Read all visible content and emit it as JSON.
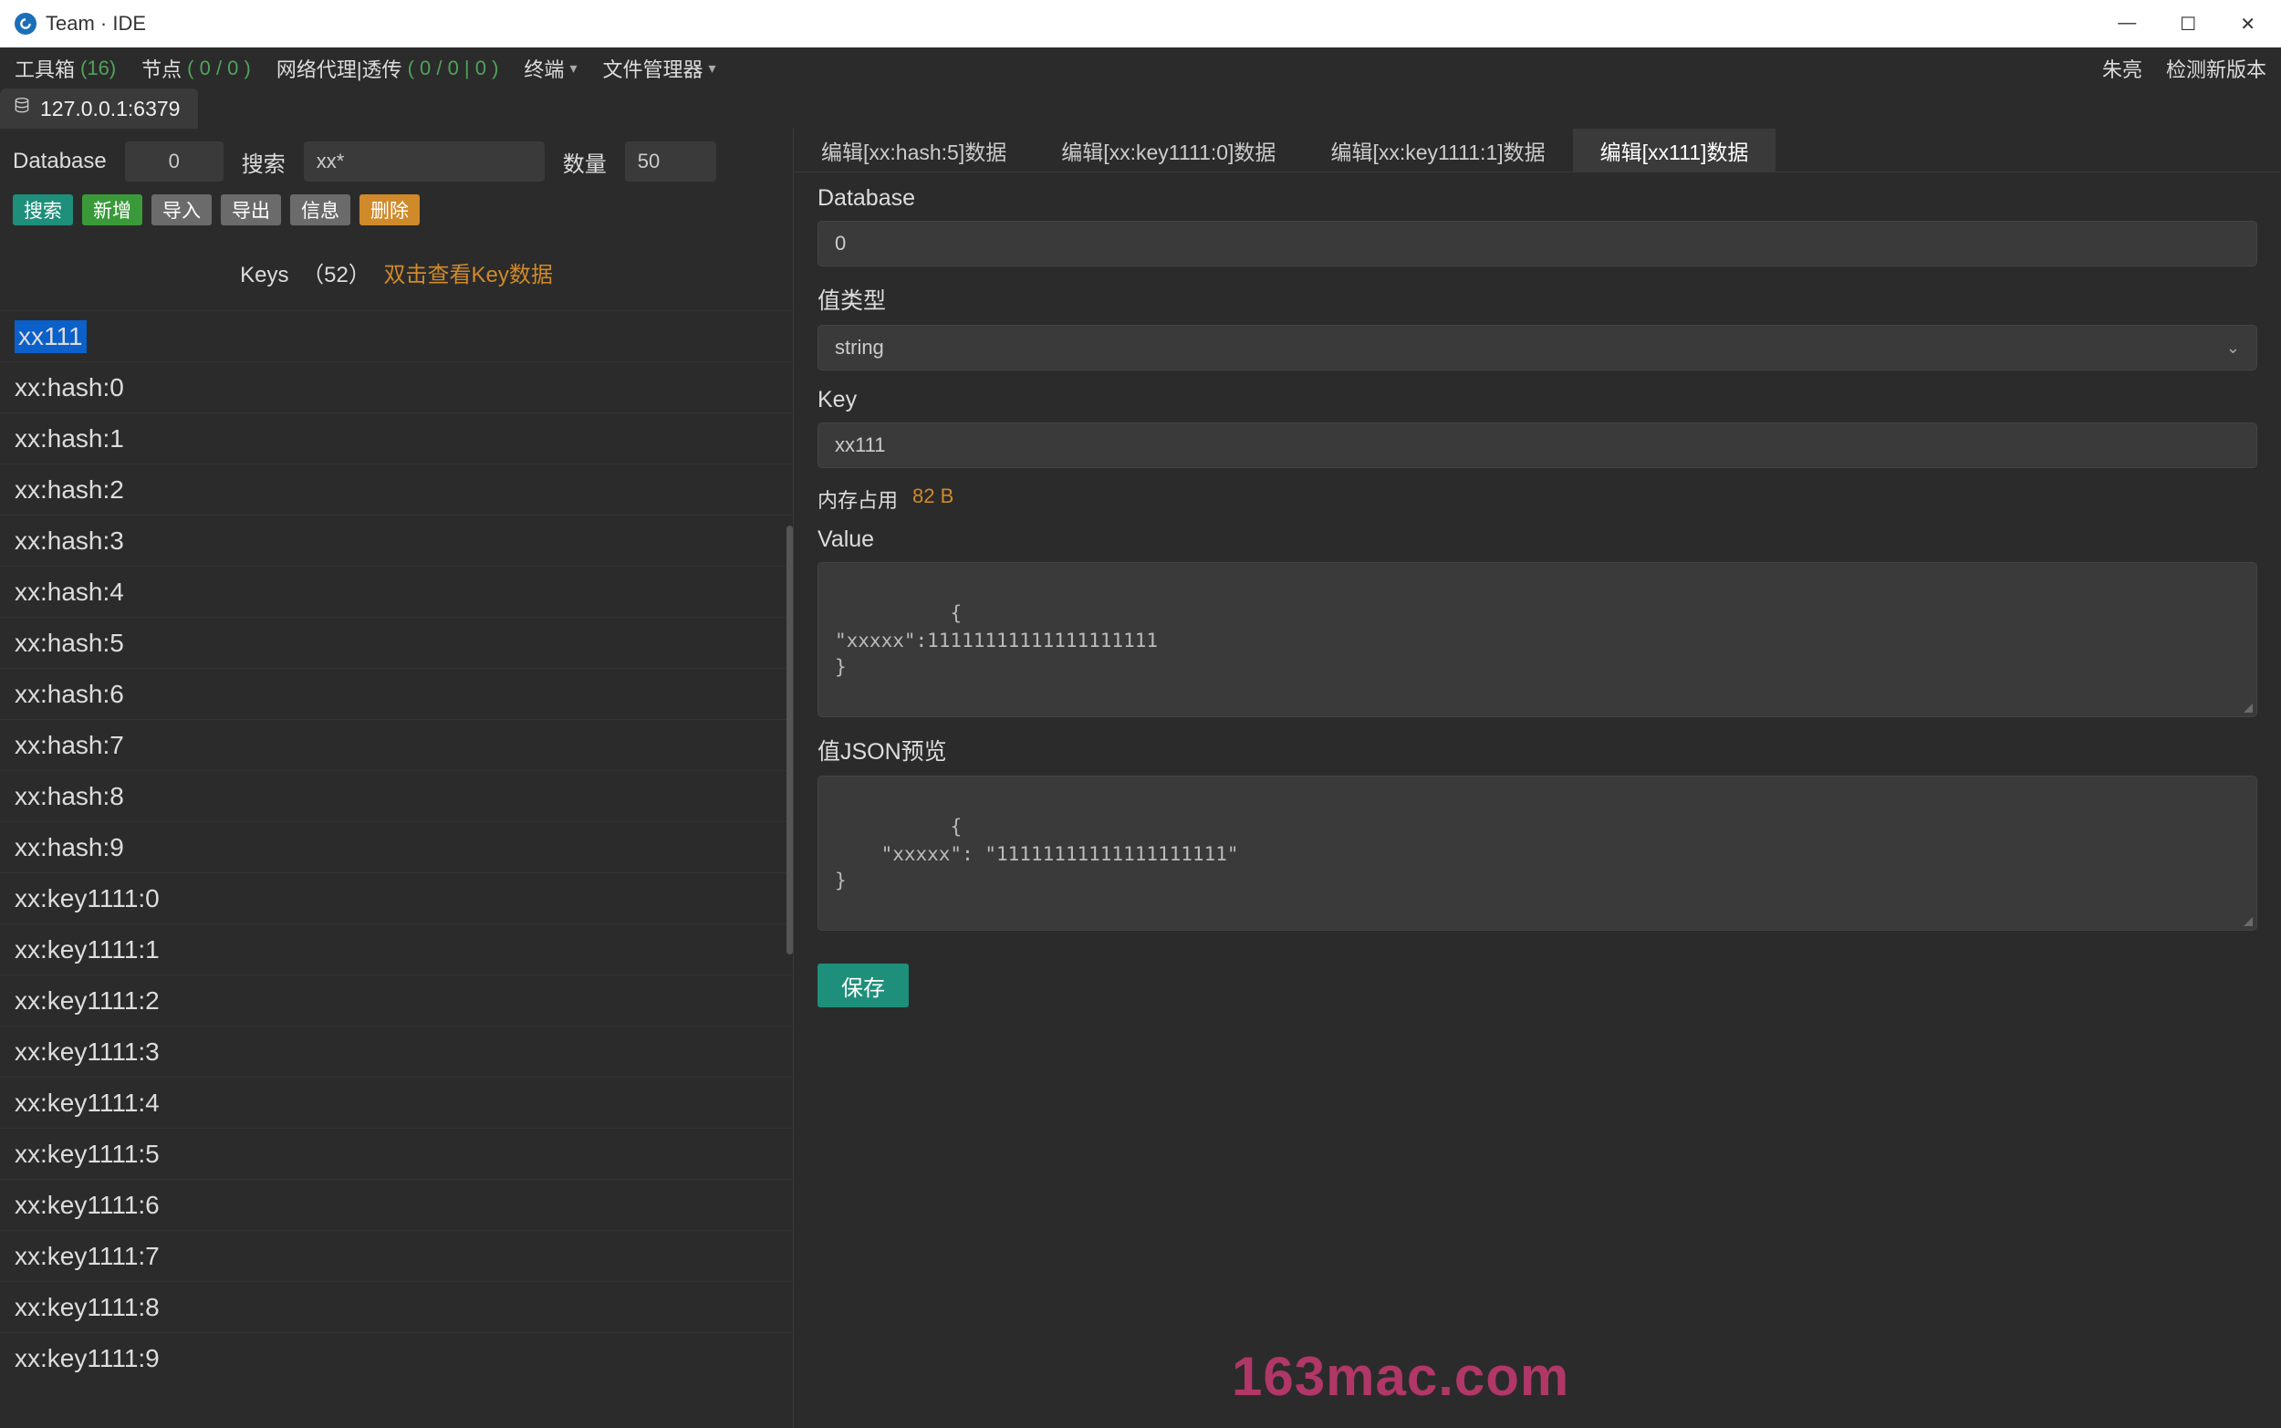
{
  "window": {
    "title": "Team · IDE"
  },
  "menubar": {
    "toolbox": {
      "label": "工具箱",
      "count": "(16)"
    },
    "nodes": {
      "label": "节点",
      "count": "( 0 / 0 )"
    },
    "netproxy": {
      "label": "网络代理|透传",
      "count": "( 0 / 0 | 0 )"
    },
    "terminal": "终端",
    "filemanager": "文件管理器",
    "user": "朱亮",
    "checkupdate": "检测新版本"
  },
  "connection": {
    "label": "127.0.0.1:6379"
  },
  "sidebar": {
    "filters": {
      "db_label": "Database",
      "db_value": "0",
      "search_label": "搜索",
      "search_value": "xx*",
      "count_label": "数量",
      "count_value": "50"
    },
    "actions": {
      "search": "搜索",
      "add": "新增",
      "import": "导入",
      "export": "导出",
      "info": "信息",
      "delete": "删除"
    },
    "keys_header": {
      "label": "Keys",
      "count": "（52）",
      "hint": "双击查看Key数据"
    },
    "keys": [
      "xx111",
      "xx:hash:0",
      "xx:hash:1",
      "xx:hash:2",
      "xx:hash:3",
      "xx:hash:4",
      "xx:hash:5",
      "xx:hash:6",
      "xx:hash:7",
      "xx:hash:8",
      "xx:hash:9",
      "xx:key1111:0",
      "xx:key1111:1",
      "xx:key1111:2",
      "xx:key1111:3",
      "xx:key1111:4",
      "xx:key1111:5",
      "xx:key1111:6",
      "xx:key1111:7",
      "xx:key1111:8",
      "xx:key1111:9"
    ],
    "selected_key": "xx111"
  },
  "editor": {
    "tabs": [
      "编辑[xx:hash:5]数据",
      "编辑[xx:key1111:0]数据",
      "编辑[xx:key1111:1]数据",
      "编辑[xx111]数据"
    ],
    "active_tab": 3,
    "fields": {
      "database": {
        "label": "Database",
        "value": "0"
      },
      "type": {
        "label": "值类型",
        "value": "string"
      },
      "key": {
        "label": "Key",
        "value": "xx111"
      },
      "memory": {
        "label": "内存占用",
        "value": "82 B"
      },
      "value": {
        "label": "Value",
        "content": "{\n\"xxxxx\":11111111111111111111\n}"
      },
      "json_preview": {
        "label": "值JSON预览",
        "content": "{\n    \"xxxxx\": \"11111111111111111111\"\n}"
      }
    },
    "save": "保存"
  },
  "watermark": "163mac.com"
}
